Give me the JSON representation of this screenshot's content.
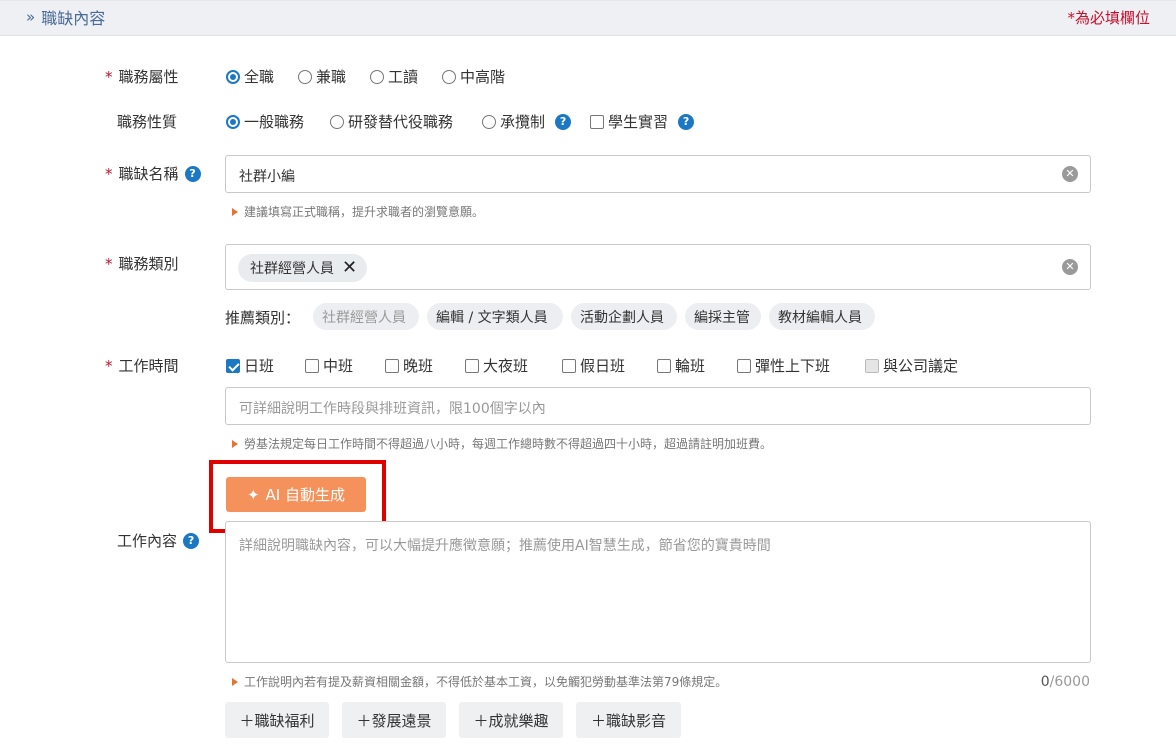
{
  "header": {
    "title": "職缺內容",
    "required_note": "*為必填欄位"
  },
  "job_type": {
    "label": "職務屬性",
    "options": [
      "全職",
      "兼職",
      "工讀",
      "中高階"
    ],
    "selected": "全職"
  },
  "job_nature": {
    "label": "職務性質",
    "options": [
      "一般職務",
      "研發替代役職務",
      "承攬制",
      "學生實習"
    ],
    "selected": "一般職務"
  },
  "job_title": {
    "label": "職缺名稱",
    "value": "社群小編",
    "hint": "建議填寫正式職稱，提升求職者的瀏覽意願。"
  },
  "job_category": {
    "label": "職務類別",
    "tag": "社群經營人員",
    "recommend_label": "推薦類別：",
    "recommendations": [
      "社群經營人員",
      "編輯 / 文字類人員",
      "活動企劃人員",
      "編採主管",
      "教材編輯人員"
    ]
  },
  "work_time": {
    "label": "工作時間",
    "options": [
      "日班",
      "中班",
      "晚班",
      "大夜班",
      "假日班",
      "輪班",
      "彈性上下班",
      "與公司議定"
    ],
    "checked": "日班",
    "placeholder": "可詳細說明工作時段與排班資訊，限100個字以內",
    "hint": "勞基法規定每日工作時間不得超過八小時，每週工作總時數不得超過四十小時，超過請註明加班費。"
  },
  "ai_button": {
    "label": "AI 自動生成"
  },
  "job_content": {
    "label": "工作內容",
    "placeholder": "詳細說明職缺內容，可以大幅提升應徵意願；推薦使用AI智慧生成，節省您的寶貴時間",
    "hint": "工作說明內若有提及薪資相關金額，不得低於基本工資，以免觸犯勞動基準法第79條規定。",
    "count": "0",
    "max": "/6000"
  },
  "add_buttons": [
    "＋職缺福利",
    "＋發展遠景",
    "＋成就樂趣",
    "＋職缺影音"
  ],
  "colors": {
    "accent": "#1b78c4",
    "required": "#c8102e",
    "ai_button": "#f5925c",
    "highlight": "#e00000"
  }
}
